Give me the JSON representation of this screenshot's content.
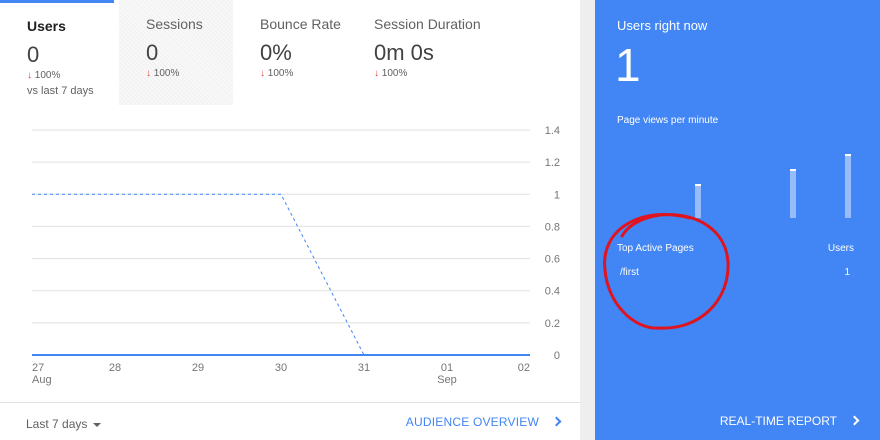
{
  "tabs": [
    {
      "label": "Users",
      "value": "0",
      "change_arrow": "↓",
      "change": "100%",
      "sub": "vs last 7 days",
      "active": true
    },
    {
      "label": "Sessions",
      "value": "0",
      "change_arrow": "↓",
      "change": "100%",
      "sub": "",
      "hatched": true
    },
    {
      "label": "Bounce Rate",
      "value": "0%",
      "change_arrow": "↓",
      "change": "100%",
      "sub": ""
    },
    {
      "label": "Session Duration",
      "value": "0m 0s",
      "change_arrow": "↓",
      "change": "100%",
      "sub": ""
    }
  ],
  "chart_data": {
    "type": "line",
    "x_ticks": [
      {
        "label": "27",
        "sub": "Aug"
      },
      {
        "label": "28",
        "sub": ""
      },
      {
        "label": "29",
        "sub": ""
      },
      {
        "label": "30",
        "sub": ""
      },
      {
        "label": "31",
        "sub": ""
      },
      {
        "label": "01",
        "sub": "Sep"
      },
      {
        "label": "02",
        "sub": ""
      }
    ],
    "y_ticks": [
      "1.4",
      "1.2",
      "1",
      "0.8",
      "0.6",
      "0.4",
      "0.2",
      "0"
    ],
    "ylim": [
      0,
      1.4
    ],
    "series": [
      {
        "style": "dashed",
        "color": "#4285f4",
        "x": [
          "27 Aug",
          "28 Aug",
          "29 Aug",
          "30 Aug",
          "31 Aug",
          "01 Sep",
          "02 Sep"
        ],
        "values": [
          1,
          1,
          1,
          1,
          0,
          0,
          0
        ]
      },
      {
        "style": "solid",
        "color": "#4285f4",
        "x": [
          "27 Aug",
          "28 Aug",
          "29 Aug",
          "30 Aug",
          "31 Aug",
          "01 Sep",
          "02 Sep"
        ],
        "values": [
          0,
          0,
          0,
          0,
          0,
          0,
          0
        ]
      }
    ],
    "grid": true,
    "y_axis_side": "right"
  },
  "footer": {
    "date_range": "Last 7 days",
    "audience_link": "AUDIENCE OVERVIEW"
  },
  "realtime": {
    "title": "Users right now",
    "count": "1",
    "page_views_label": "Page views per minute",
    "bars": [
      0.45,
      0.65,
      0.85
    ],
    "top_pages_header": "Top Active Pages",
    "users_header": "Users",
    "pages": [
      {
        "path": "/first",
        "users": "1"
      }
    ],
    "report_link": "REAL-TIME REPORT"
  },
  "colors": {
    "accent": "#4285f4",
    "down_arrow": "#db4437",
    "annotation": "#e0141e"
  }
}
